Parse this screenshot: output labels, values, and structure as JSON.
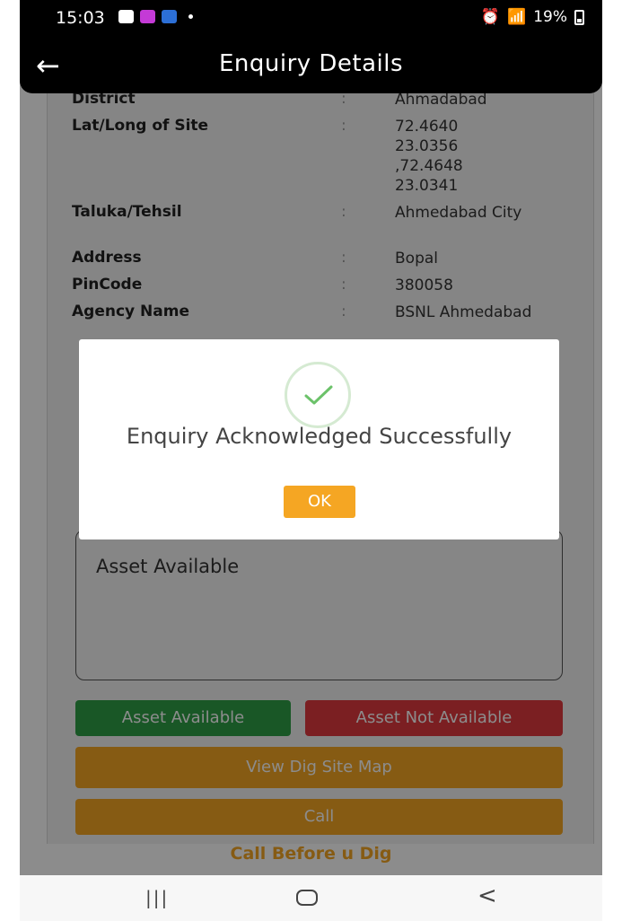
{
  "status_bar": {
    "time": "15:03",
    "battery": "19%",
    "left_icons": [
      "gallery-icon",
      "z-app-icon",
      "app-icon"
    ],
    "right_icons": [
      "alarm-icon",
      "wifi-icon",
      "signal-icon",
      "volte-icon"
    ]
  },
  "app_bar": {
    "title": "Enquiry Details"
  },
  "details": [
    {
      "key": "District",
      "sep": ":",
      "value": "Ahmadabad"
    },
    {
      "key": "Lat/Long of Site",
      "sep": ":",
      "value": "72.4640 23.0356 ,72.4648 23.0341"
    },
    {
      "key": "Taluka/Tehsil",
      "sep": ":",
      "value": "Ahmedabad City"
    },
    {
      "key": "Address",
      "sep": ":",
      "value": "Bopal"
    },
    {
      "key": "PinCode",
      "sep": ":",
      "value": "380058"
    },
    {
      "key": "Agency Name",
      "sep": ":",
      "value": "BSNL Ahmedabad"
    }
  ],
  "remarks": {
    "text": "Asset Available"
  },
  "buttons": {
    "asset_available": "Asset Available",
    "asset_not_available": "Asset Not Available",
    "view_map": "View Dig Site Map",
    "call": "Call"
  },
  "footer": {
    "brand": "Call Before u Dig"
  },
  "dialog": {
    "message": "Enquiry Acknowledged Successfully",
    "ok_label": "OK"
  },
  "colors": {
    "accent_orange": "#f5a623",
    "green": "#2e9e45",
    "red": "#e0393e"
  }
}
